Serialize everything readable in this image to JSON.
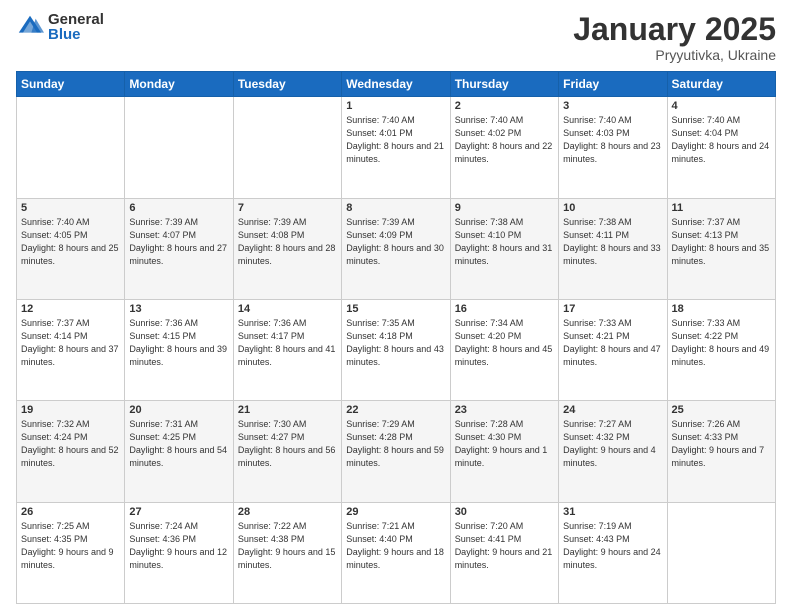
{
  "logo": {
    "general": "General",
    "blue": "Blue"
  },
  "header": {
    "month": "January 2025",
    "location": "Pryyutivka, Ukraine"
  },
  "weekdays": [
    "Sunday",
    "Monday",
    "Tuesday",
    "Wednesday",
    "Thursday",
    "Friday",
    "Saturday"
  ],
  "weeks": [
    [
      {
        "day": "",
        "info": ""
      },
      {
        "day": "",
        "info": ""
      },
      {
        "day": "",
        "info": ""
      },
      {
        "day": "1",
        "info": "Sunrise: 7:40 AM\nSunset: 4:01 PM\nDaylight: 8 hours and 21 minutes."
      },
      {
        "day": "2",
        "info": "Sunrise: 7:40 AM\nSunset: 4:02 PM\nDaylight: 8 hours and 22 minutes."
      },
      {
        "day": "3",
        "info": "Sunrise: 7:40 AM\nSunset: 4:03 PM\nDaylight: 8 hours and 23 minutes."
      },
      {
        "day": "4",
        "info": "Sunrise: 7:40 AM\nSunset: 4:04 PM\nDaylight: 8 hours and 24 minutes."
      }
    ],
    [
      {
        "day": "5",
        "info": "Sunrise: 7:40 AM\nSunset: 4:05 PM\nDaylight: 8 hours and 25 minutes."
      },
      {
        "day": "6",
        "info": "Sunrise: 7:39 AM\nSunset: 4:07 PM\nDaylight: 8 hours and 27 minutes."
      },
      {
        "day": "7",
        "info": "Sunrise: 7:39 AM\nSunset: 4:08 PM\nDaylight: 8 hours and 28 minutes."
      },
      {
        "day": "8",
        "info": "Sunrise: 7:39 AM\nSunset: 4:09 PM\nDaylight: 8 hours and 30 minutes."
      },
      {
        "day": "9",
        "info": "Sunrise: 7:38 AM\nSunset: 4:10 PM\nDaylight: 8 hours and 31 minutes."
      },
      {
        "day": "10",
        "info": "Sunrise: 7:38 AM\nSunset: 4:11 PM\nDaylight: 8 hours and 33 minutes."
      },
      {
        "day": "11",
        "info": "Sunrise: 7:37 AM\nSunset: 4:13 PM\nDaylight: 8 hours and 35 minutes."
      }
    ],
    [
      {
        "day": "12",
        "info": "Sunrise: 7:37 AM\nSunset: 4:14 PM\nDaylight: 8 hours and 37 minutes."
      },
      {
        "day": "13",
        "info": "Sunrise: 7:36 AM\nSunset: 4:15 PM\nDaylight: 8 hours and 39 minutes."
      },
      {
        "day": "14",
        "info": "Sunrise: 7:36 AM\nSunset: 4:17 PM\nDaylight: 8 hours and 41 minutes."
      },
      {
        "day": "15",
        "info": "Sunrise: 7:35 AM\nSunset: 4:18 PM\nDaylight: 8 hours and 43 minutes."
      },
      {
        "day": "16",
        "info": "Sunrise: 7:34 AM\nSunset: 4:20 PM\nDaylight: 8 hours and 45 minutes."
      },
      {
        "day": "17",
        "info": "Sunrise: 7:33 AM\nSunset: 4:21 PM\nDaylight: 8 hours and 47 minutes."
      },
      {
        "day": "18",
        "info": "Sunrise: 7:33 AM\nSunset: 4:22 PM\nDaylight: 8 hours and 49 minutes."
      }
    ],
    [
      {
        "day": "19",
        "info": "Sunrise: 7:32 AM\nSunset: 4:24 PM\nDaylight: 8 hours and 52 minutes."
      },
      {
        "day": "20",
        "info": "Sunrise: 7:31 AM\nSunset: 4:25 PM\nDaylight: 8 hours and 54 minutes."
      },
      {
        "day": "21",
        "info": "Sunrise: 7:30 AM\nSunset: 4:27 PM\nDaylight: 8 hours and 56 minutes."
      },
      {
        "day": "22",
        "info": "Sunrise: 7:29 AM\nSunset: 4:28 PM\nDaylight: 8 hours and 59 minutes."
      },
      {
        "day": "23",
        "info": "Sunrise: 7:28 AM\nSunset: 4:30 PM\nDaylight: 9 hours and 1 minute."
      },
      {
        "day": "24",
        "info": "Sunrise: 7:27 AM\nSunset: 4:32 PM\nDaylight: 9 hours and 4 minutes."
      },
      {
        "day": "25",
        "info": "Sunrise: 7:26 AM\nSunset: 4:33 PM\nDaylight: 9 hours and 7 minutes."
      }
    ],
    [
      {
        "day": "26",
        "info": "Sunrise: 7:25 AM\nSunset: 4:35 PM\nDaylight: 9 hours and 9 minutes."
      },
      {
        "day": "27",
        "info": "Sunrise: 7:24 AM\nSunset: 4:36 PM\nDaylight: 9 hours and 12 minutes."
      },
      {
        "day": "28",
        "info": "Sunrise: 7:22 AM\nSunset: 4:38 PM\nDaylight: 9 hours and 15 minutes."
      },
      {
        "day": "29",
        "info": "Sunrise: 7:21 AM\nSunset: 4:40 PM\nDaylight: 9 hours and 18 minutes."
      },
      {
        "day": "30",
        "info": "Sunrise: 7:20 AM\nSunset: 4:41 PM\nDaylight: 9 hours and 21 minutes."
      },
      {
        "day": "31",
        "info": "Sunrise: 7:19 AM\nSunset: 4:43 PM\nDaylight: 9 hours and 24 minutes."
      },
      {
        "day": "",
        "info": ""
      }
    ]
  ]
}
